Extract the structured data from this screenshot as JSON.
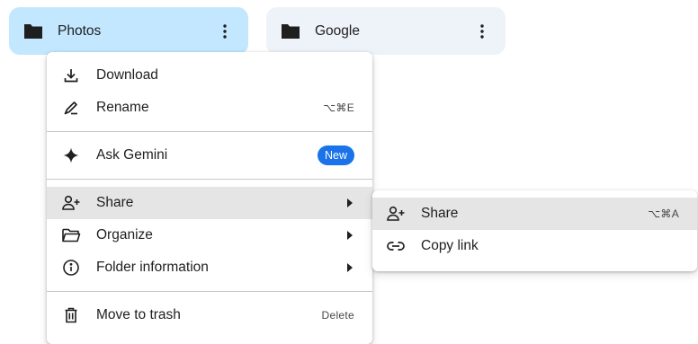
{
  "folders": [
    {
      "name": "Photos",
      "icon": "folder-icon",
      "selected": true,
      "more_icon": "more-vert-icon"
    },
    {
      "name": "Google",
      "icon": "folder-icon",
      "selected": false,
      "more_icon": "more-vert-icon"
    }
  ],
  "context_menu": {
    "items": [
      {
        "label": "Download",
        "icon": "download-icon"
      },
      {
        "label": "Rename",
        "icon": "rename-icon",
        "shortcut": "⌥⌘E"
      },
      {
        "label": "Ask Gemini",
        "icon": "gemini-sparkle-icon",
        "badge": "New"
      },
      {
        "label": "Share",
        "icon": "add-person-icon",
        "has_submenu": true,
        "highlighted": true
      },
      {
        "label": "Organize",
        "icon": "folder-open-icon",
        "has_submenu": true
      },
      {
        "label": "Folder information",
        "icon": "info-icon",
        "has_submenu": true
      },
      {
        "label": "Move to trash",
        "icon": "trash-icon",
        "shortcut": "Delete"
      }
    ]
  },
  "share_submenu": {
    "items": [
      {
        "label": "Share",
        "icon": "add-person-icon",
        "shortcut": "⌥⌘A",
        "highlighted": true
      },
      {
        "label": "Copy link",
        "icon": "link-icon"
      }
    ]
  },
  "colors": {
    "selected_chip": "#c2e7ff",
    "plain_chip": "#eef2f9",
    "highlight_row": "#e5e5e5",
    "badge": "#1a73e8"
  }
}
